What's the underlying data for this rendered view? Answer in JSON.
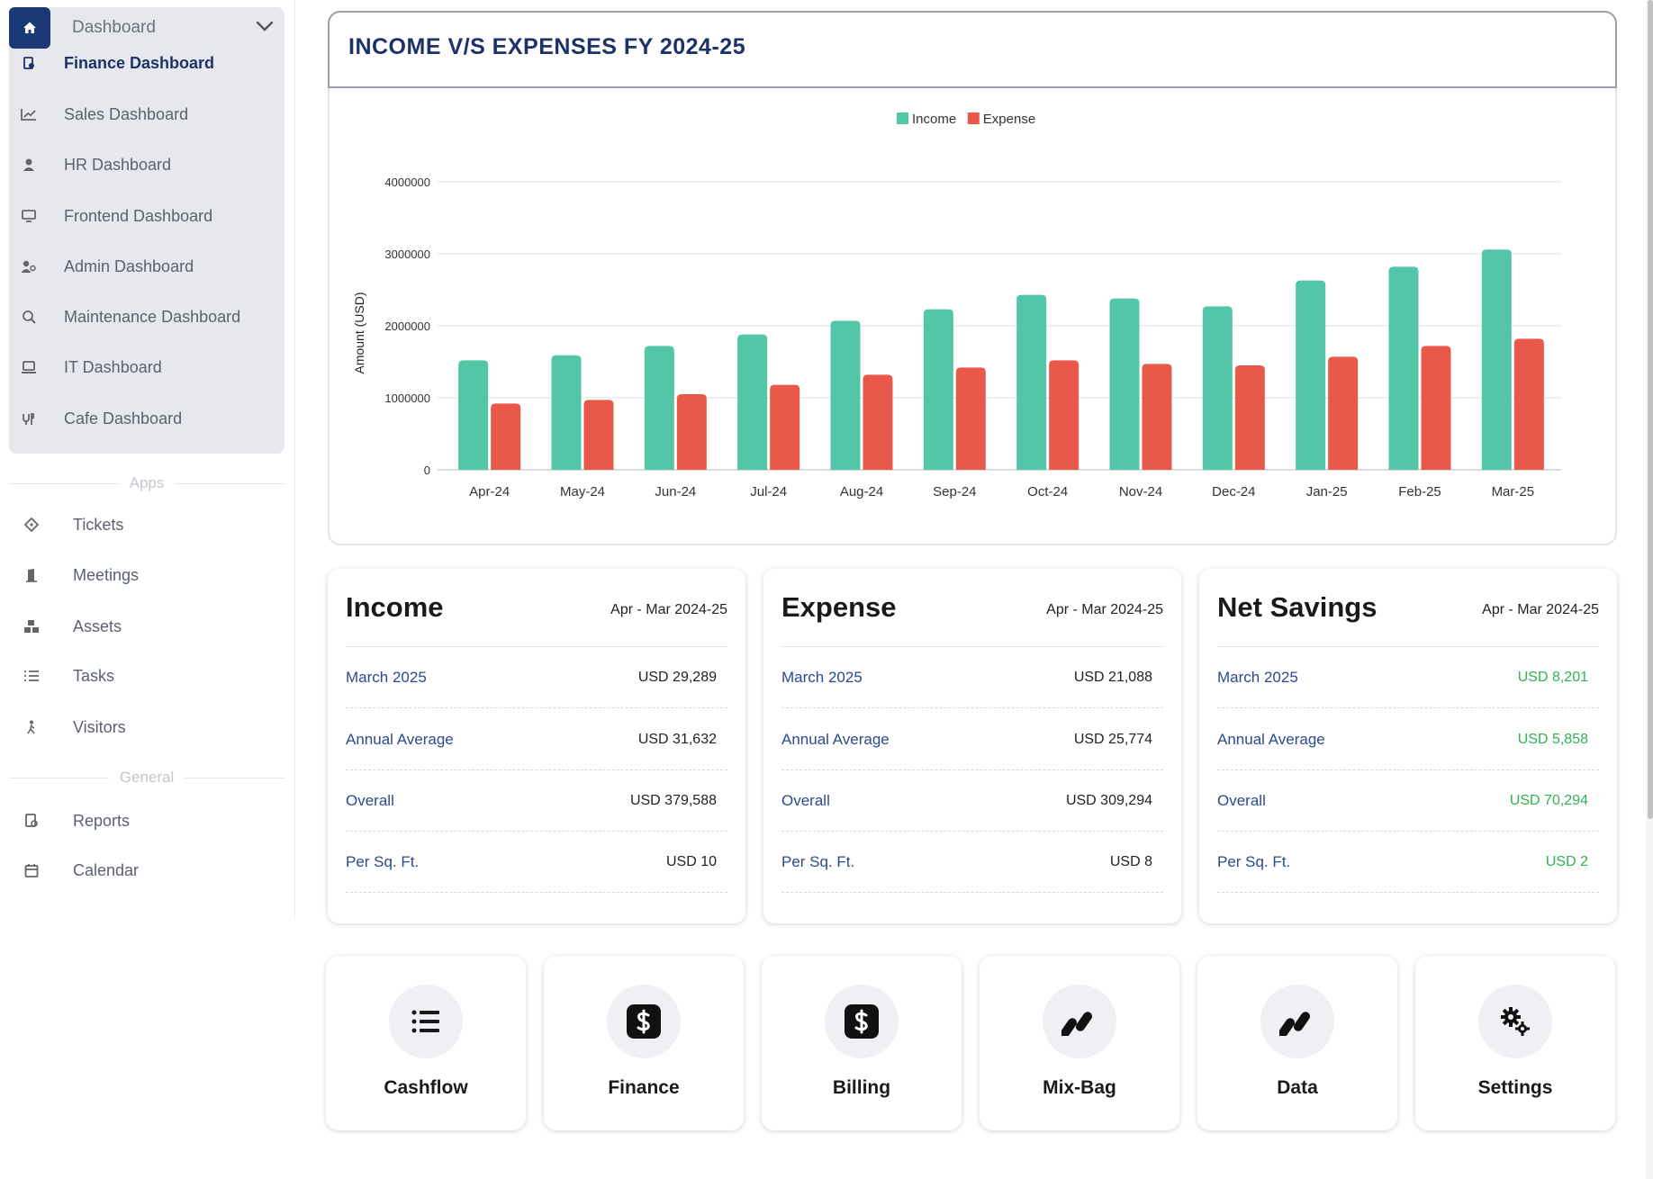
{
  "sidebar": {
    "dashboard_group": {
      "title": "Dashboard",
      "items": [
        {
          "label": "Finance Dashboard",
          "icon": "finance-icon",
          "active": true
        },
        {
          "label": "Sales Dashboard",
          "icon": "chart-line-icon",
          "active": false
        },
        {
          "label": "HR Dashboard",
          "icon": "user-icon",
          "active": false
        },
        {
          "label": "Frontend Dashboard",
          "icon": "monitor-icon",
          "active": false
        },
        {
          "label": "Admin Dashboard",
          "icon": "users-icon",
          "active": false
        },
        {
          "label": "Maintenance Dashboard",
          "icon": "search-doc-icon",
          "active": false
        },
        {
          "label": "IT Dashboard",
          "icon": "laptop-icon",
          "active": false
        },
        {
          "label": "Cafe Dashboard",
          "icon": "cafe-icon",
          "active": false
        }
      ]
    },
    "apps_label": "Apps",
    "apps": [
      {
        "label": "Tickets",
        "icon": "ticket-icon"
      },
      {
        "label": "Meetings",
        "icon": "door-icon"
      },
      {
        "label": "Assets",
        "icon": "boxes-icon"
      },
      {
        "label": "Tasks",
        "icon": "list-icon"
      },
      {
        "label": "Visitors",
        "icon": "walker-icon"
      }
    ],
    "general_label": "General",
    "general": [
      {
        "label": "Reports",
        "icon": "report-icon"
      },
      {
        "label": "Calendar",
        "icon": "calendar-icon"
      }
    ]
  },
  "chart_card": {
    "title": "INCOME V/S EXPENSES FY 2024-25"
  },
  "chart_data": {
    "type": "bar",
    "title": "INCOME V/S EXPENSES FY 2024-25",
    "xlabel": "",
    "ylabel": "Amount (USD)",
    "categories": [
      "Apr-24",
      "May-24",
      "Jun-24",
      "Jul-24",
      "Aug-24",
      "Sep-24",
      "Oct-24",
      "Nov-24",
      "Dec-24",
      "Jan-25",
      "Feb-25",
      "Mar-25"
    ],
    "series": [
      {
        "name": "Income",
        "color": "#52c6a6",
        "values": [
          1520000,
          1590000,
          1720000,
          1880000,
          2070000,
          2230000,
          2430000,
          2380000,
          2270000,
          2630000,
          2820000,
          3060000
        ]
      },
      {
        "name": "Expense",
        "color": "#e9594a",
        "values": [
          920000,
          970000,
          1050000,
          1180000,
          1320000,
          1420000,
          1520000,
          1470000,
          1450000,
          1570000,
          1720000,
          1820000
        ]
      }
    ],
    "yticks": [
      "0",
      "1000000",
      "2000000",
      "3000000",
      "4000000"
    ],
    "ylim": [
      0,
      4000000
    ],
    "grid": true,
    "legend": "top-center"
  },
  "stats": [
    {
      "title": "Income",
      "period": "Apr - Mar 2024-25",
      "rows": [
        {
          "label": "March 2025",
          "value": "USD  29,289"
        },
        {
          "label": "Annual Average",
          "value": "USD 31,632"
        },
        {
          "label": "Overall",
          "value": "USD 379,588"
        },
        {
          "label": "Per Sq. Ft.",
          "value": "USD 10"
        }
      ]
    },
    {
      "title": "Expense",
      "period": "Apr - Mar 2024-25",
      "rows": [
        {
          "label": "March 2025",
          "value": "USD 21,088"
        },
        {
          "label": "Annual Average",
          "value": "USD 25,774"
        },
        {
          "label": "Overall",
          "value": "USD 309,294"
        },
        {
          "label": "Per Sq. Ft.",
          "value": "USD 8"
        }
      ]
    },
    {
      "title": "Net Savings",
      "period": "Apr - Mar 2024-25",
      "rows": [
        {
          "label": "March 2025",
          "value": "USD 8,201"
        },
        {
          "label": "Annual Average",
          "value": "USD 5,858"
        },
        {
          "label": "Overall",
          "value": "USD 70,294"
        },
        {
          "label": "Per Sq. Ft.",
          "value": "USD 2"
        }
      ]
    }
  ],
  "tiles": [
    {
      "label": "Cashflow",
      "icon": "list-icon"
    },
    {
      "label": "Finance",
      "icon": "dollar-icon"
    },
    {
      "label": "Billing",
      "icon": "dollar-icon"
    },
    {
      "label": "Mix-Bag",
      "icon": "capsules-icon"
    },
    {
      "label": "Data",
      "icon": "capsules-icon"
    },
    {
      "label": "Settings",
      "icon": "gears-icon"
    }
  ],
  "colors": {
    "brand": "#1d3268",
    "income": "#52c6a6",
    "expense": "#e9594a",
    "positive": "#2fb352"
  }
}
